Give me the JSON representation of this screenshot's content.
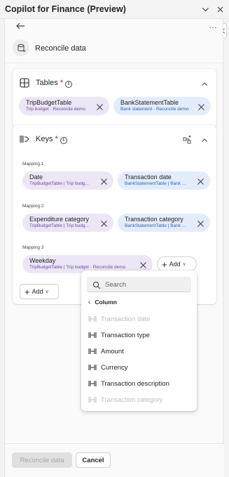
{
  "window": {
    "title": "Copilot for Finance (Preview)",
    "collapse_icon": "chevron-down-icon",
    "close_icon": "close-icon"
  },
  "toolbar": {
    "back_icon": "arrow-left-icon",
    "more_label": "…"
  },
  "header": {
    "icon": "database-icon",
    "title": "Reconcile data"
  },
  "tables_card": {
    "title": "Tables",
    "required_mark": "*",
    "info_icon": "info-icon",
    "chips": [
      {
        "name": "TripBudgetTable",
        "sub": "Trip budget · Reconcile demo",
        "color": "purple"
      },
      {
        "name": "BankStatementTable",
        "sub": "Bank statement · Reconcile demo",
        "color": "blue"
      }
    ]
  },
  "keys_card": {
    "title": "Keys",
    "required_mark": "*",
    "info_icon": "info-icon",
    "auto_icon": "sparkle-map-icon",
    "mappings": [
      {
        "label": "Mapping 1",
        "left": {
          "name": "Date",
          "sub": "TripBudgetTable | Trip budg..."
        },
        "right": {
          "name": "Transaction date",
          "sub": "BankStatementTable | Bank ..."
        }
      },
      {
        "label": "Mapping 2",
        "left": {
          "name": "Expenditure category",
          "sub": "TripBudgetTable | Trip budg..."
        },
        "right": {
          "name": "Transaction category",
          "sub": "BankStatementTable | Bank ..."
        }
      },
      {
        "label": "Mapping 3",
        "left": {
          "name": "Weekday",
          "sub": "TripBudgetTable | Trip budget - Reconcile demo"
        },
        "right": null
      }
    ],
    "add_chip_label": "Add",
    "add_button_label": "Add"
  },
  "dropdown": {
    "search_placeholder": "Search",
    "section_label": "Column",
    "options": [
      {
        "label": "Transaction date",
        "disabled": true
      },
      {
        "label": "Transaction type",
        "disabled": false
      },
      {
        "label": "Amount",
        "disabled": false
      },
      {
        "label": "Currency",
        "disabled": false
      },
      {
        "label": "Transaction description",
        "disabled": false
      },
      {
        "label": "Transaction category",
        "disabled": true
      }
    ]
  },
  "footer": {
    "primary_label": "Reconcile data",
    "primary_disabled": true,
    "secondary_label": "Cancel"
  },
  "colors": {
    "chip_purple": "#ece6f6",
    "chip_blue": "#e3ecfa",
    "required": "#c50f1f"
  }
}
